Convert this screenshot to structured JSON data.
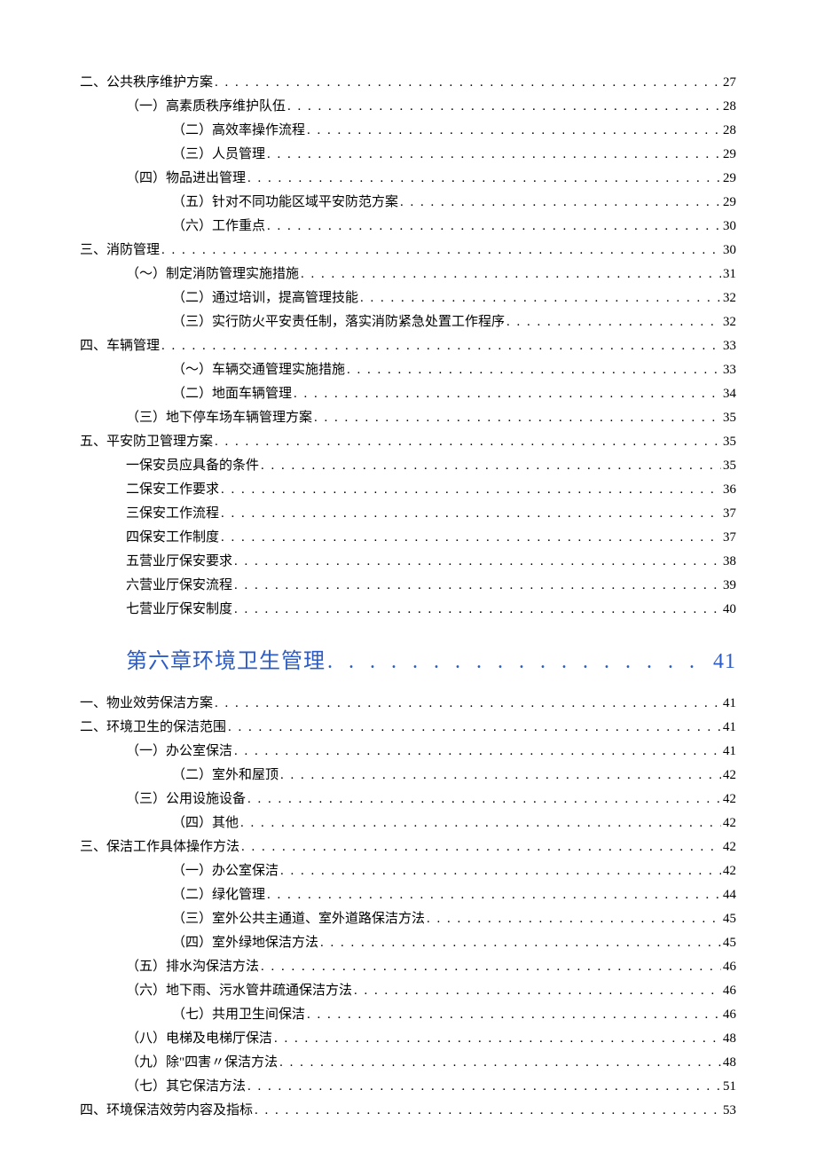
{
  "toc": [
    {
      "label": "二、公共秩序维护方案",
      "page": "27",
      "indent": 0,
      "style": "normal"
    },
    {
      "label": "（一）高素质秩序维护队伍",
      "page": "28",
      "indent": 1,
      "style": "normal"
    },
    {
      "label": "（二）高效率操作流程",
      "page": "28",
      "indent": 2,
      "style": "normal"
    },
    {
      "label": "（三）人员管理",
      "page": "29",
      "indent": 2,
      "style": "normal"
    },
    {
      "label": "（四）物品进出管理",
      "page": "29",
      "indent": 1,
      "style": "normal"
    },
    {
      "label": "（五）针对不同功能区域平安防范方案",
      "page": "29",
      "indent": 2,
      "style": "normal"
    },
    {
      "label": "（六）工作重点",
      "page": "30",
      "indent": 2,
      "style": "normal"
    },
    {
      "label": "三、消防管理",
      "page": "30",
      "indent": 0,
      "style": "normal"
    },
    {
      "label": "（〜）制定消防管理实施措施",
      "page": "31",
      "indent": 1,
      "style": "normal"
    },
    {
      "label": "（二）通过培训，提高管理技能",
      "page": "32",
      "indent": 2,
      "style": "normal"
    },
    {
      "label": "（三）实行防火平安责任制，落实消防紧急处置工作程序",
      "page": "32",
      "indent": 2,
      "style": "normal"
    },
    {
      "label": "四、车辆管理",
      "page": "33",
      "indent": 0,
      "style": "normal"
    },
    {
      "label": "（〜）车辆交通管理实施措施",
      "page": "33",
      "indent": 2,
      "style": "normal"
    },
    {
      "label": "（二）地面车辆管理",
      "page": "34",
      "indent": 2,
      "style": "normal"
    },
    {
      "label": "（三）地下停车场车辆管理方案",
      "page": "35",
      "indent": 1,
      "style": "normal"
    },
    {
      "label": "五、平安防卫管理方案",
      "page": "35",
      "indent": 0,
      "style": "normal"
    },
    {
      "label": "一保安员应具备的条件",
      "page": "35",
      "indent": 1,
      "style": "normal"
    },
    {
      "label": "二保安工作要求",
      "page": "36",
      "indent": 1,
      "style": "normal"
    },
    {
      "label": "三保安工作流程",
      "page": "37",
      "indent": 1,
      "style": "normal"
    },
    {
      "label": "四保安工作制度",
      "page": "37",
      "indent": 1,
      "style": "normal"
    },
    {
      "label": "五营业厅保安要求",
      "page": "38",
      "indent": 1,
      "style": "normal"
    },
    {
      "label": "六营业厅保安流程",
      "page": "39",
      "indent": 1,
      "style": "normal"
    },
    {
      "label": "七营业厅保安制度",
      "page": "40",
      "indent": 1,
      "style": "normal"
    },
    {
      "label": "第六章环境卫生管理",
      "page": "41",
      "indent": 1,
      "style": "chapter"
    },
    {
      "label": "一、物业效劳保洁方案",
      "page": "41",
      "indent": 0,
      "style": "normal"
    },
    {
      "label": "二、环境卫生的保洁范围",
      "page": "41",
      "indent": 0,
      "style": "normal"
    },
    {
      "label": "（一）办公室保洁",
      "page": "41",
      "indent": 1,
      "style": "normal"
    },
    {
      "label": "（二）室外和屋顶",
      "page": "42",
      "indent": 2,
      "style": "normal"
    },
    {
      "label": "（三）公用设施设备",
      "page": "42",
      "indent": 1,
      "style": "normal"
    },
    {
      "label": "（四）其他",
      "page": "42",
      "indent": 2,
      "style": "normal"
    },
    {
      "label": "三、保洁工作具体操作方法",
      "page": "42",
      "indent": 0,
      "style": "normal"
    },
    {
      "label": "（一）办公室保洁",
      "page": "42",
      "indent": 2,
      "style": "normal"
    },
    {
      "label": "（二）绿化管理",
      "page": "44",
      "indent": 2,
      "style": "normal"
    },
    {
      "label": "（三）室外公共主通道、室外道路保洁方法",
      "page": "45",
      "indent": 2,
      "style": "normal"
    },
    {
      "label": "（四）室外绿地保洁方法",
      "page": "45",
      "indent": 2,
      "style": "normal"
    },
    {
      "label": "（五）排水沟保洁方法",
      "page": "46",
      "indent": 1,
      "style": "normal"
    },
    {
      "label": "（六）地下雨、污水管井疏通保洁方法",
      "page": "46",
      "indent": 1,
      "style": "normal"
    },
    {
      "label": "（七）共用卫生间保洁",
      "page": "46",
      "indent": 2,
      "style": "normal"
    },
    {
      "label": "（八）电梯及电梯厅保洁",
      "page": "48",
      "indent": 1,
      "style": "normal"
    },
    {
      "label": "（九）除\"四害〃保洁方法",
      "page": "48",
      "indent": 1,
      "style": "normal"
    },
    {
      "label": "（七）其它保洁方法",
      "page": "51",
      "indent": 1,
      "style": "normal"
    },
    {
      "label": "四、环境保洁效劳内容及指标",
      "page": "53",
      "indent": 0,
      "style": "normal"
    }
  ]
}
